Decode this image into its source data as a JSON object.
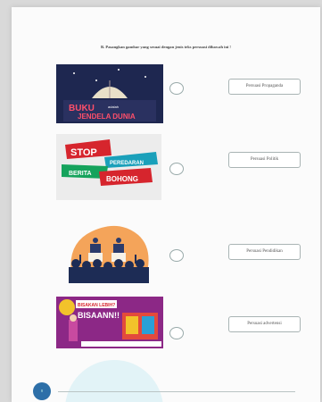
{
  "instruction": "B. Pasangkan gambar yang sesuai dengan jenis teks persuasi dibawah ini !",
  "images": [
    {
      "icon": "book-cover-image",
      "title_line1": "BUKU",
      "title_small": "adalah",
      "title_line2": "JENDELA DUNIA"
    },
    {
      "icon": "stop-hoax-image",
      "stop": "STOP",
      "peredaran": "PEREDARAN",
      "berita": "BERITA",
      "bohong": "BOHONG"
    },
    {
      "icon": "political-rally-image"
    },
    {
      "icon": "product-advert-image",
      "headline_1": "BISAKAN LEBIH?",
      "headline_2": "BISAANN!!"
    }
  ],
  "options": [
    "Persuasi Propaganda",
    "Persuasi Politik",
    "Persuasi Pendidikan",
    "Persuasi advertensi"
  ],
  "page_number": "8",
  "colors": {
    "page": "#fbfbfb",
    "accent_blue": "#2d6fa8",
    "stop_red": "#d6252d",
    "green_band": "#15a35c"
  }
}
